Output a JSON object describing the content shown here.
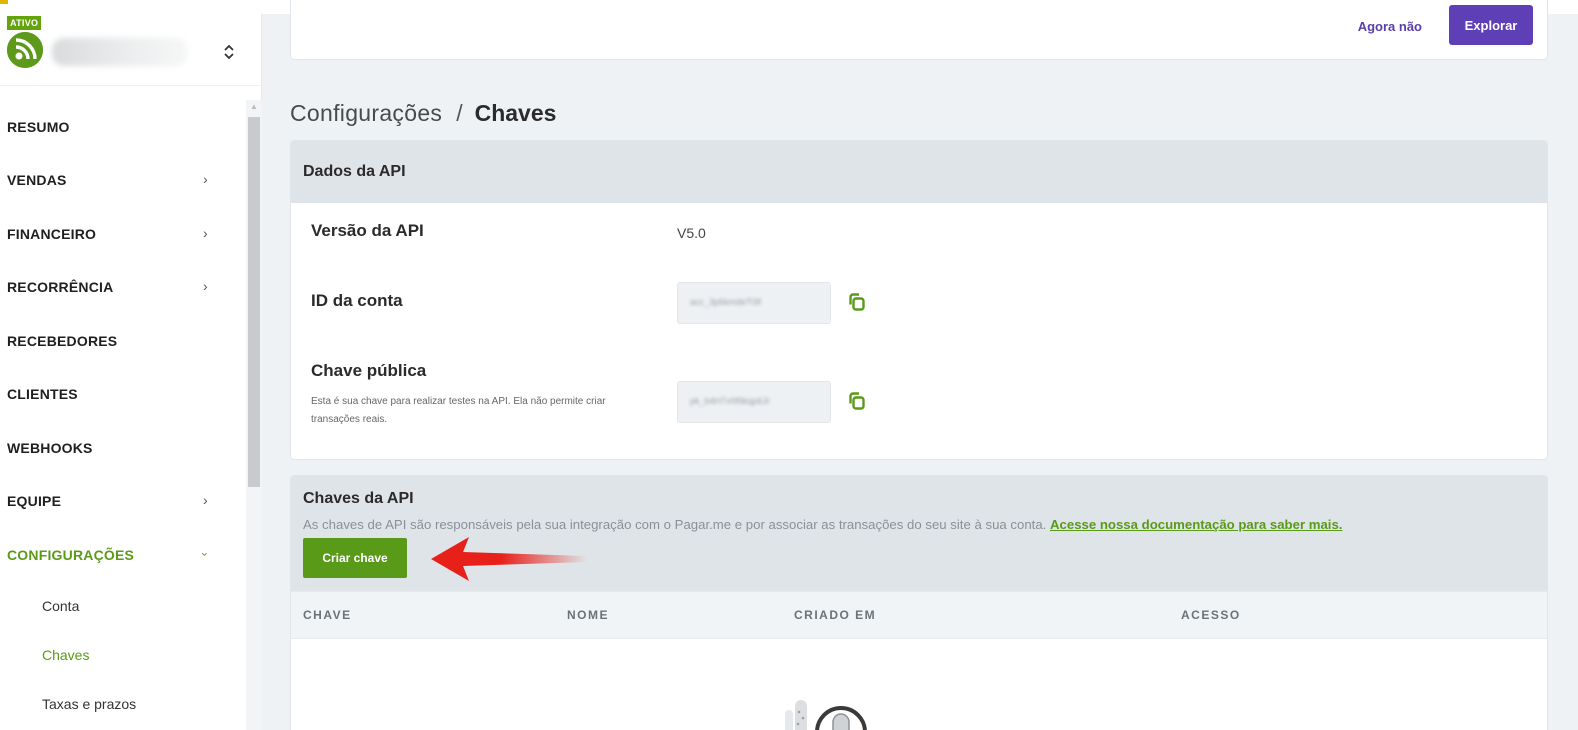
{
  "account": {
    "status_badge": "ATIVO"
  },
  "sidebar": {
    "items": [
      {
        "label": "RESUMO",
        "has_chevron": false
      },
      {
        "label": "VENDAS",
        "has_chevron": true
      },
      {
        "label": "FINANCEIRO",
        "has_chevron": true
      },
      {
        "label": "RECORRÊNCIA",
        "has_chevron": true
      },
      {
        "label": "RECEBEDORES",
        "has_chevron": false
      },
      {
        "label": "CLIENTES",
        "has_chevron": false
      },
      {
        "label": "WEBHOOKS",
        "has_chevron": false
      },
      {
        "label": "EQUIPE",
        "has_chevron": true
      },
      {
        "label": "CONFIGURAÇÕES",
        "has_chevron": true,
        "expanded": true,
        "active": true
      }
    ],
    "chevron_glyph": "›",
    "subitems": [
      {
        "label": "Conta"
      },
      {
        "label": "Chaves",
        "active": true
      },
      {
        "label": "Taxas e prazos"
      }
    ]
  },
  "banner": {
    "dismiss_label": "Agora não",
    "explore_label": "Explorar"
  },
  "breadcrumb": {
    "parent": "Configurações",
    "separator": "/",
    "current": "Chaves"
  },
  "api_data": {
    "title": "Dados da API",
    "version_label": "Versão da API",
    "version_value": "V5.0",
    "account_id_label": "ID da conta",
    "account_id_value": "acc_3p6kmdeT0lf",
    "public_key_label": "Chave pública",
    "public_key_desc": "Esta é sua chave para realizar testes na API. Ela não permite criar transações reais.",
    "public_key_value": "pk_b4H7v0f9kqp6Jr"
  },
  "api_keys": {
    "title": "Chaves da API",
    "description": "As chaves de API são responsáveis pela sua integração com o Pagar.me e por associar as transações do seu site à sua conta.",
    "doc_link": "Acesse nossa documentação para saber mais.",
    "create_button": "Criar chave",
    "columns": [
      "CHAVE",
      "NOME",
      "CRIADO EM",
      "ACESSO"
    ]
  },
  "colors": {
    "brand_green": "#5a9a19",
    "brand_purple": "#5f3fb5",
    "annotation_arrow": "#e8201a"
  }
}
